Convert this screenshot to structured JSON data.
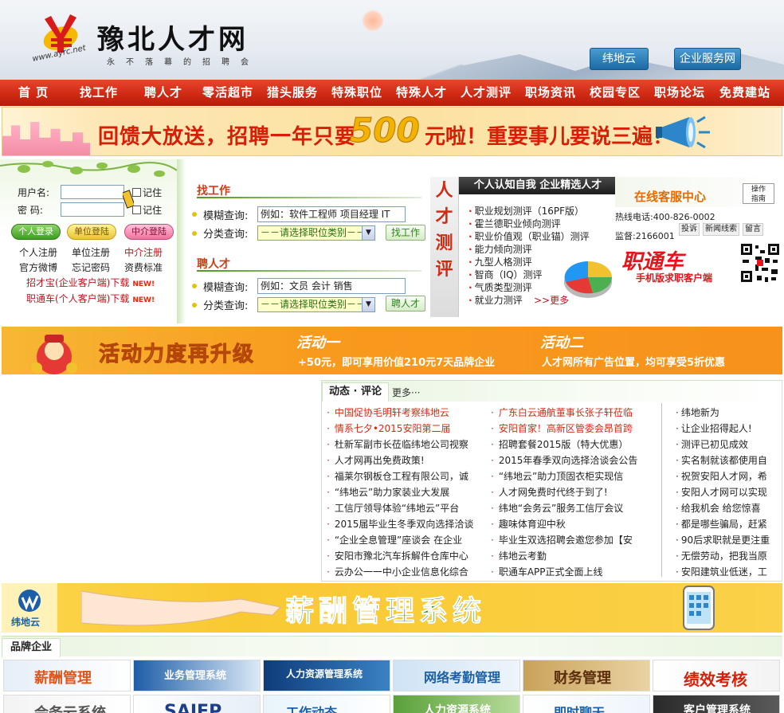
{
  "header": {
    "logo_text": "豫北人才网",
    "logo_url": "www.ayrc.net",
    "slogan": "永不落幕的招聘会",
    "buttons": [
      "纬地云",
      "企业服务网"
    ]
  },
  "nav": {
    "items": [
      "首  页",
      "找工作",
      "聘人才",
      "零活超市",
      "猎头服务",
      "特殊职位",
      "特殊人才",
      "人才测评",
      "职场资讯",
      "校园专区",
      "职场论坛",
      "免费建站"
    ]
  },
  "promo": {
    "text_before": "回馈大放送，招聘一年只要",
    "number": "500",
    "text_after": "元啦！重要事儿要说三遍！"
  },
  "login": {
    "username_label": "用户名:",
    "password_label": "密  码:",
    "remember_label": "记住",
    "buttons": [
      "个人登录",
      "单位登陆",
      "中介登陆"
    ],
    "links_row1": [
      "个人注册",
      "单位注册",
      "中介注册"
    ],
    "links_row2": [
      "官方微博",
      "忘记密码",
      "资费标准"
    ],
    "downloads": [
      "招才宝(企业客户端)下载",
      "职通车(个人客户端)下载"
    ],
    "new_badge": "NEW!"
  },
  "search": {
    "find_job": {
      "title": "找工作",
      "fuzzy_label": "模糊查询:",
      "fuzzy_placeholder": "例如：软件工程师 项目经理 IT",
      "category_label": "分类查询:",
      "category_value": "－－请选择职位类别－－",
      "button": "找工作"
    },
    "hire": {
      "title": "聘人才",
      "fuzzy_label": "模糊查询:",
      "fuzzy_placeholder": "例如：文员 会计 销售",
      "category_label": "分类查询:",
      "category_value": "－－请选择职位类别－－",
      "button": "聘人才"
    }
  },
  "test": {
    "side_title": [
      "人",
      "才",
      "测",
      "评"
    ],
    "header": "个人认知自我  企业精选人才",
    "items": [
      "职业规划测评（16PF版）",
      "霍兰德职业倾向测评",
      "职业价值观（职业锚）测评",
      "能力倾向测评",
      "九型人格测评",
      "智商（IQ）测评",
      "气质类型测评",
      "就业力测评"
    ],
    "more": ">>更多"
  },
  "service": {
    "title": "在线客服中心",
    "guide": "操作\n指南",
    "hotline": "热线电话:400-826-0002",
    "supervise": "监督:2166001",
    "pills": [
      "投诉",
      "新闻线索",
      "留言"
    ],
    "zhitongche": "职通车",
    "zhitongche_sub": "手机版求职客户端"
  },
  "activity": {
    "title": "活动力度再升级",
    "act1_title": "活动一",
    "act1_desc": "+50元，即可享用价值210元7天品牌企业",
    "act2_title": "活动二",
    "act2_desc": "人才网所有广告位置，均可享受5折优惠"
  },
  "news": {
    "tab_active": "动态 · 评论",
    "tab_more": "更多···",
    "col1": [
      "中国促协毛明轩考察纬地云",
      "情系七夕•2015安阳第二届",
      "杜新军副市长莅临纬地公司视察",
      "人才网再出免费政策!",
      "福莱尔钢板仓工程有限公司，诚",
      "“纬地云”助力家装业大发展",
      "工信厅领导体验“纬地云”平台",
      "2015届毕业生冬季双向选择洽谈",
      "“企业全息管理”座谈会 在企业",
      "安阳市豫北汽车拆解件仓库中心",
      "云办公一一中小企业信息化综合"
    ],
    "col1_red": [
      true,
      true,
      false,
      false,
      false,
      false,
      false,
      false,
      false,
      false,
      false
    ],
    "col2": [
      "广东白云通航董事长张子轩莅临",
      "安阳首家！高新区管委会昂首跨",
      "招聘套餐2015版（特大优惠）",
      "2015年春季双向选择洽谈会公告",
      "“纬地云”助力顶固衣柜实现信",
      "人才网免费时代终于到了!",
      "纬地“会务云”服务工信厅会议",
      "趣味体育迎中秋",
      "毕业生双选招聘会邀您参加【安",
      "纬地云考勤",
      "职通车APP正式全面上线"
    ],
    "col2_red": [
      true,
      true,
      false,
      false,
      false,
      false,
      false,
      false,
      false,
      false,
      false
    ],
    "col3": [
      "纬地新为",
      "让企业招得起人!",
      "测评已初见成效",
      "实名制就该都使用自",
      "祝贺安阳人才网，希",
      "安阳人才网可以实现",
      "给我机会 给您惊喜",
      "都是哪些骗局，赶紧",
      "90后求职就是更注重",
      "无偿劳动，把我当原",
      "安阳建筑业低迷，工"
    ]
  },
  "salary": {
    "logo_text": "纬地云",
    "title": "薪酬管理系统"
  },
  "brand": {
    "tab": "品牌企业",
    "tiles_row1": [
      "薪酬管理",
      "业务管理系统",
      "人力资源管理系统",
      "网络考勤管理",
      "财务管理",
      "绩效考核"
    ],
    "tiles_row2": [
      "会务云系统",
      "SAIEP",
      "工作动态",
      "人力资源系统",
      "即时聊天",
      "客户管理系统"
    ]
  },
  "colors": {
    "nav_red": "#d02a14",
    "accent_orange": "#f7921b",
    "link_red": "#d12b14",
    "green": "#2f8420"
  }
}
